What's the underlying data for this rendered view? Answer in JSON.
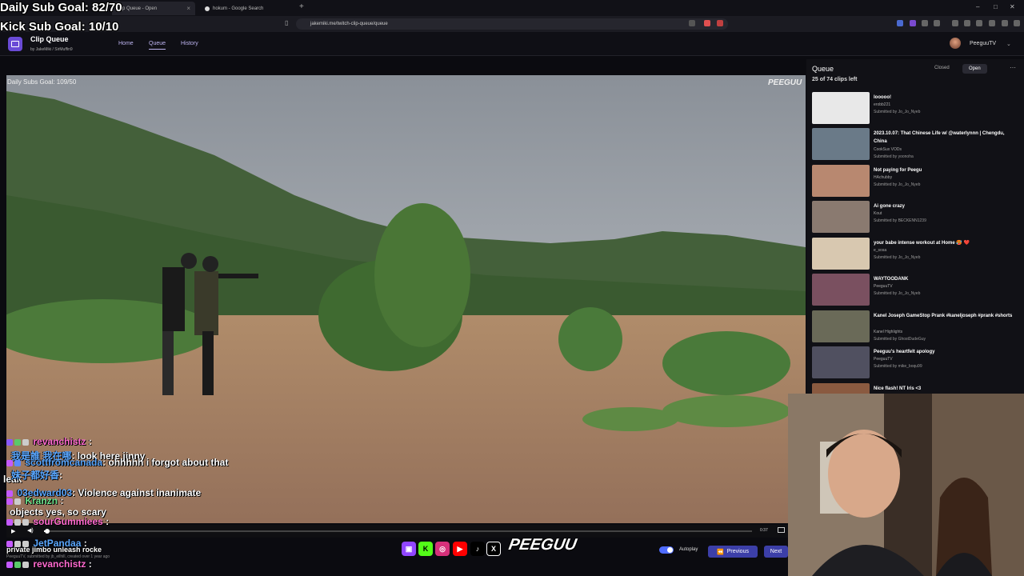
{
  "overlay": {
    "daily_goal": "Daily Sub Goal: 82/70",
    "kick_goal": "Kick Sub Goal: 10/10"
  },
  "browser": {
    "tabs": [
      {
        "label": "Clip Queue - Open",
        "active": true
      },
      {
        "label": "hokum - Google Search",
        "active": false
      }
    ],
    "url": "jakemiki.me/twitch-clip-queue/queue"
  },
  "app": {
    "title": "Clip Queue",
    "subtitle": "by JakeMiki / SirMuffin9",
    "nav": [
      "Home",
      "Queue",
      "History"
    ],
    "username": "PeeguuTV"
  },
  "video": {
    "watermark_goal": "Daily Subs Goal: 109/50",
    "watermark_brand": "PEEGUU",
    "time": "0:37",
    "progress": 0.005
  },
  "queue": {
    "title": "Queue",
    "count": "25 of 74 clips left",
    "closed_label": "Closed",
    "open_label": "Open",
    "items": [
      {
        "title": "looooo!",
        "channel": "erobb221",
        "submitter": "Submitted by Jo_Jo_Nyeb",
        "thumb": "#e8e8e8"
      },
      {
        "title": "2023.10.07: That Chinese Life w/ @waterlynnn | Chengdu, China",
        "channel": "CookSux VODs",
        "submitter": "Submitted by yoonoha",
        "thumb": "#6a7a88"
      },
      {
        "title": "Not paying for Peegu",
        "channel": "HAchubby",
        "submitter": "Submitted by Jo_Jo_Nyeb",
        "thumb": "#b88870"
      },
      {
        "title": "Ai gone crazy",
        "channel": "Kout",
        "submitter": "Submitted by BECKENN1239",
        "thumb": "#8a7a70"
      },
      {
        "title": "your babe intense workout at Home 🥵 ❤️",
        "channel": "e_sosa",
        "submitter": "Submitted by Jo_Jo_Nyeb",
        "thumb": "#d8c8b0"
      },
      {
        "title": "WAYTOODANK",
        "channel": "PeeguuTV",
        "submitter": "Submitted by Jo_Jo_Nyeb",
        "thumb": "#7a5060"
      },
      {
        "title": "Kanel Joseph GameStop Prank #kaneljoseph #prank #shorts",
        "channel": "Kanel Highlights",
        "submitter": "Submitted by GhostDudeGuy",
        "thumb": "#6a6a58"
      },
      {
        "title": "Peeguu's heartfelt apology",
        "channel": "PeeguuTV",
        "submitter": "Submitted by mike_boqu99",
        "thumb": "#505060"
      },
      {
        "title": "Nice flash! NT Iris <3",
        "channel": "",
        "submitter": "",
        "thumb": "#8a5a40"
      }
    ]
  },
  "chat": [
    {
      "name": "revanchistz",
      "text": "",
      "color": "nm"
    },
    {
      "name": "我是誰 我在哪",
      "text": ": look here jinny",
      "color": "nm2"
    },
    {
      "name": "scottfromcanada",
      "text": ": ohhhhh i forgot about that",
      "color": "nm2"
    },
    {
      "name": "",
      "text": "leak",
      "color": ""
    },
    {
      "name": "妹子都好香",
      "text": ":",
      "color": "nm2"
    },
    {
      "name": "03edward03",
      "text": ": Violence against inanimate",
      "color": "nm2"
    },
    {
      "name": "Kranzn",
      "text": ":",
      "color": "nm3"
    },
    {
      "name": "",
      "text": "objects yes, so scary",
      "color": ""
    },
    {
      "name": "sourGummiees",
      "text": ":",
      "color": "nm"
    },
    {
      "name": "JetPandaa",
      "text": ":",
      "color": "nm2"
    },
    {
      "name": "",
      "text": "private jimbo unleash rocke",
      "color": ""
    },
    {
      "name": "revanchistz",
      "text": ":",
      "color": "nm"
    }
  ],
  "footer": {
    "clip_meta": "PeeguuTV, submitted by jb_eilhill, created over 1 year ago",
    "brand": "PEEGUU",
    "autoplay_label": "Autoplay",
    "autoplay_on": true,
    "prev_label": "Previous",
    "next_label": "Next"
  },
  "colors": {
    "accent": "#3c3fa8",
    "logo": "#6a4bd6"
  }
}
